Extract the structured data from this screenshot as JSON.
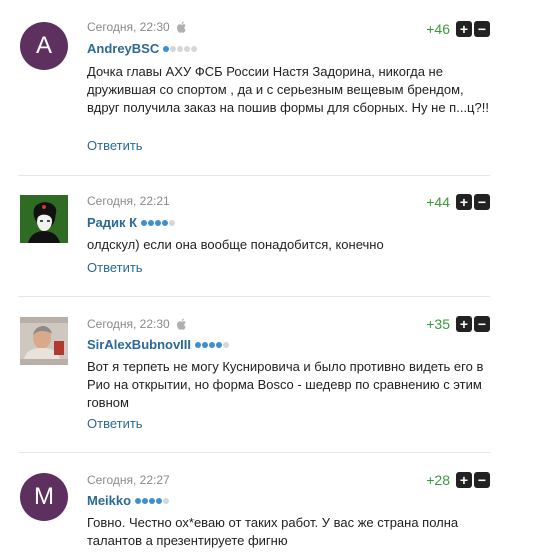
{
  "comments": [
    {
      "avatar_letter": "A",
      "avatar_color": "#5e3060",
      "time": "Сегодня, 22:30",
      "apple": true,
      "user": "AndreyBSC",
      "rank": 1,
      "score": "+46",
      "text": "Дочка главы АХУ ФСБ России Настя Задорина, никогда не дружившая со спортом , да и с серьезным вещевым брендом, вдруг получила заказ на пошив формы для сборных. Ну не п...ц?!!",
      "reply": "Ответить"
    },
    {
      "avatar_letter": "",
      "avatar_color": "#3f7a2a",
      "time": "Сегодня, 22:21",
      "apple": false,
      "user": "Радик К",
      "rank": 4,
      "score": "+44",
      "text": "олдскул) если она вообще понадобится, конечно",
      "reply": "Ответить"
    },
    {
      "avatar_letter": "",
      "avatar_color": "#b8b0a8",
      "time": "Сегодня, 22:30",
      "apple": true,
      "user": "SirAlexBubnovIII",
      "rank": 4,
      "score": "+35",
      "text": "Вот я терпеть не могу Куснировича и было противно видеть его в Рио на открытии, но форма Bosco - шедевр по сравнению с этим говном",
      "reply": "Ответить"
    },
    {
      "avatar_letter": "M",
      "avatar_color": "#5e3060",
      "time": "Сегодня, 22:27",
      "apple": false,
      "user": "Meikko",
      "rank": 4,
      "score": "+28",
      "text": "Говно. Честно ох*еваю от таких работ. У вас же страна полна талантов а презентируете фигню",
      "reply": ""
    }
  ],
  "vote_up_symbol": "+",
  "vote_down_symbol": "−"
}
